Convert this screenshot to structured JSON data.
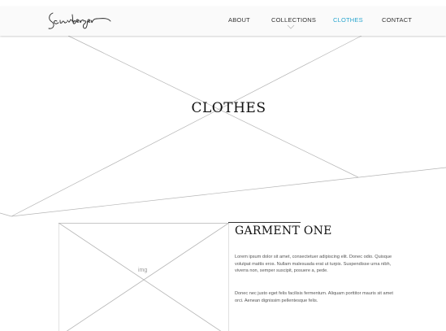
{
  "header": {
    "logo_text": "Schönberger",
    "nav": [
      {
        "label": "ABOUT",
        "active": false
      },
      {
        "label": "COLLECTIONS",
        "active": false,
        "has_dropdown": true
      },
      {
        "label": "CLOTHES",
        "active": true
      },
      {
        "label": "CONTACT",
        "active": false
      }
    ],
    "active_color": "#2aa6cf"
  },
  "hero": {
    "title": "CLOTHES"
  },
  "product": {
    "image_label": "img",
    "title": "GARMENT ONE",
    "paragraphs": [
      "Lorem ipsum dolor sit amet, consectetuer adipiscing elit. Donec odio. Quisque volutpat mattis eros. Nullam malesuada erat ut turpis. Suspendisse urna nibh, viverra non, semper suscipit, posuere a, pede.",
      "Donec nec justo eget felis facilisis fermentum. Aliquam porttitor mauris sit amet orci. Aenean dignissim pellentesque felis."
    ]
  }
}
